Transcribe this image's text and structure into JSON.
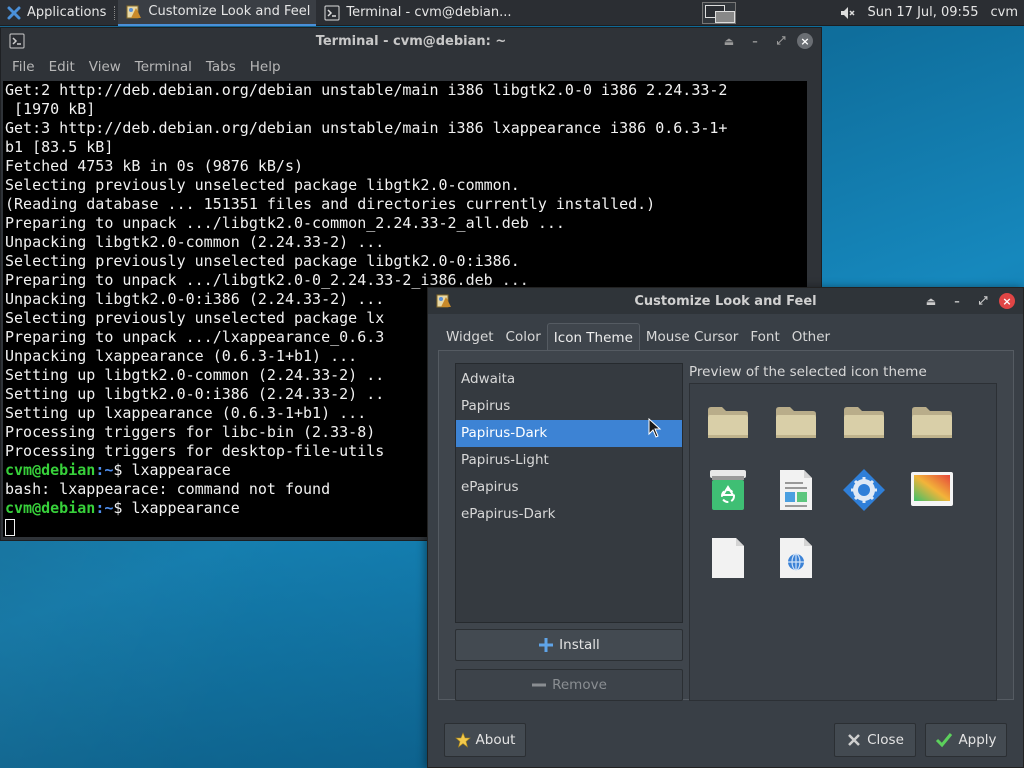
{
  "panel": {
    "applications_label": "Applications",
    "tasks": [
      {
        "label": "Customize Look and Feel",
        "icon": "appearance-icon",
        "active": true
      },
      {
        "label": "Terminal - cvm@debian...",
        "icon": "terminal-icon",
        "active": false
      }
    ],
    "clock": "Sun 17 Jul, 09:55",
    "user": "cvm",
    "volume_icon": "volume-muted-icon"
  },
  "terminal": {
    "title": "Terminal - cvm@debian: ~",
    "menu": [
      "File",
      "Edit",
      "View",
      "Terminal",
      "Tabs",
      "Help"
    ],
    "lines": [
      "Get:2 http://deb.debian.org/debian unstable/main i386 libgtk2.0-0 i386 2.24.33-2",
      " [1970 kB]",
      "Get:3 http://deb.debian.org/debian unstable/main i386 lxappearance i386 0.6.3-1+",
      "b1 [83.5 kB]",
      "Fetched 4753 kB in 0s (9876 kB/s)",
      "Selecting previously unselected package libgtk2.0-common.",
      "(Reading database ... 151351 files and directories currently installed.)",
      "Preparing to unpack .../libgtk2.0-common_2.24.33-2_all.deb ...",
      "Unpacking libgtk2.0-common (2.24.33-2) ...",
      "Selecting previously unselected package libgtk2.0-0:i386.",
      "Preparing to unpack .../libgtk2.0-0_2.24.33-2_i386.deb ...",
      "Unpacking libgtk2.0-0:i386 (2.24.33-2) ...",
      "Selecting previously unselected package lx",
      "Preparing to unpack .../lxappearance_0.6.3",
      "Unpacking lxappearance (0.6.3-1+b1) ...",
      "Setting up libgtk2.0-common (2.24.33-2) ..",
      "Setting up libgtk2.0-0:i386 (2.24.33-2) ..",
      "Setting up lxappearance (0.6.3-1+b1) ...",
      "Processing triggers for libc-bin (2.33-8)",
      "Processing triggers for desktop-file-utils"
    ],
    "prompts": [
      {
        "user_host": "cvm@debian",
        "path": ":~",
        "symbol": "$ ",
        "command": "lxappearace"
      },
      {
        "output": "bash: lxappearace: command not found"
      },
      {
        "user_host": "cvm@debian",
        "path": ":~",
        "symbol": "$ ",
        "command": "lxappearance"
      }
    ]
  },
  "dialog": {
    "title": "Customize Look and Feel",
    "tabs": [
      "Widget",
      "Color",
      "Icon Theme",
      "Mouse Cursor",
      "Font",
      "Other"
    ],
    "active_tab": "Icon Theme",
    "themes": [
      "Adwaita",
      "Papirus",
      "Papirus-Dark",
      "Papirus-Light",
      "ePapirus",
      "ePapirus-Dark"
    ],
    "selected_theme": "Papirus-Dark",
    "install_label": "Install",
    "remove_label": "Remove",
    "preview_label": "Preview of the selected icon theme",
    "preview_icons": [
      "folder-icon",
      "folder-icon",
      "folder-icon",
      "folder-icon",
      "trash-icon",
      "document-icon",
      "settings-gear-icon",
      "image-icon",
      "blank-file-icon",
      "html-file-icon"
    ],
    "about_label": "About",
    "close_label": "Close",
    "apply_label": "Apply"
  },
  "colors": {
    "accent": "#3d83d4",
    "prompt_user": "#37d03a",
    "prompt_path": "#4f8ff0",
    "close_button": "#e04545"
  }
}
